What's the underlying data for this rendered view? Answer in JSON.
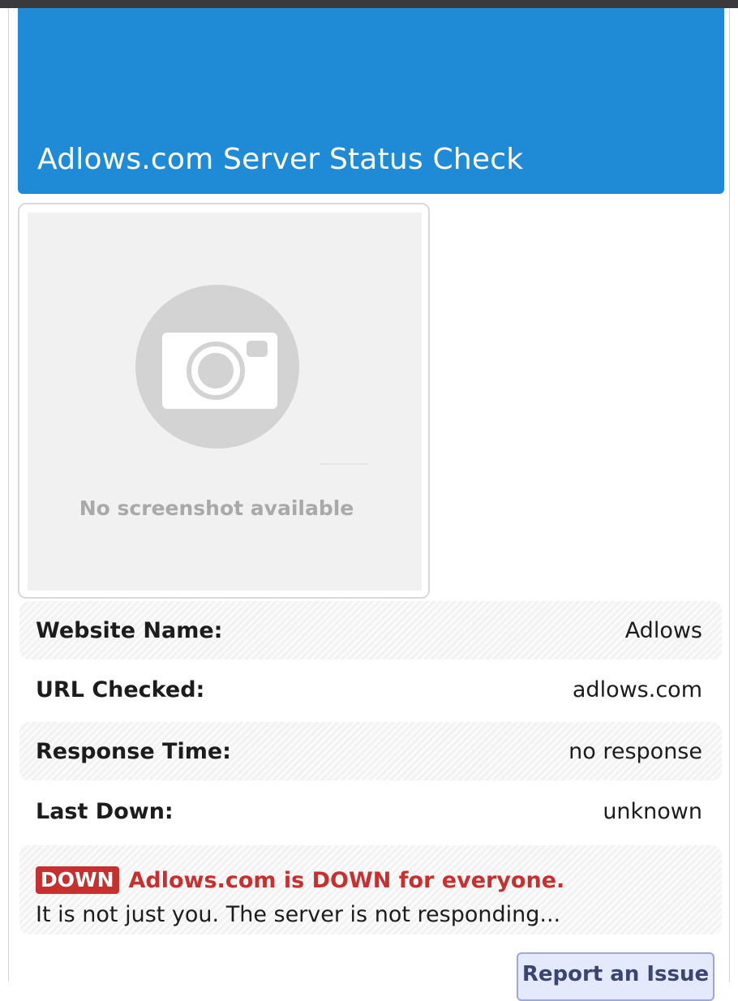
{
  "header": {
    "title": "Adlows.com Server Status Check"
  },
  "screenshot": {
    "caption": "No screenshot available",
    "icon": "camera-icon"
  },
  "info": {
    "website_name_label": "Website Name:",
    "website_name_value": "Adlows",
    "url_label": "URL Checked:",
    "url_value": "adlows.com",
    "response_label": "Response Time:",
    "response_value": "no response",
    "last_down_label": "Last Down:",
    "last_down_value": "unknown"
  },
  "status": {
    "badge": "DOWN",
    "headline": "Adlows.com is DOWN for everyone.",
    "description": "It is not just you. The server is not responding..."
  },
  "actions": {
    "report_label": "Report an Issue"
  },
  "colors": {
    "header_blue": "#1f8bd6",
    "down_red": "#c8302f"
  }
}
